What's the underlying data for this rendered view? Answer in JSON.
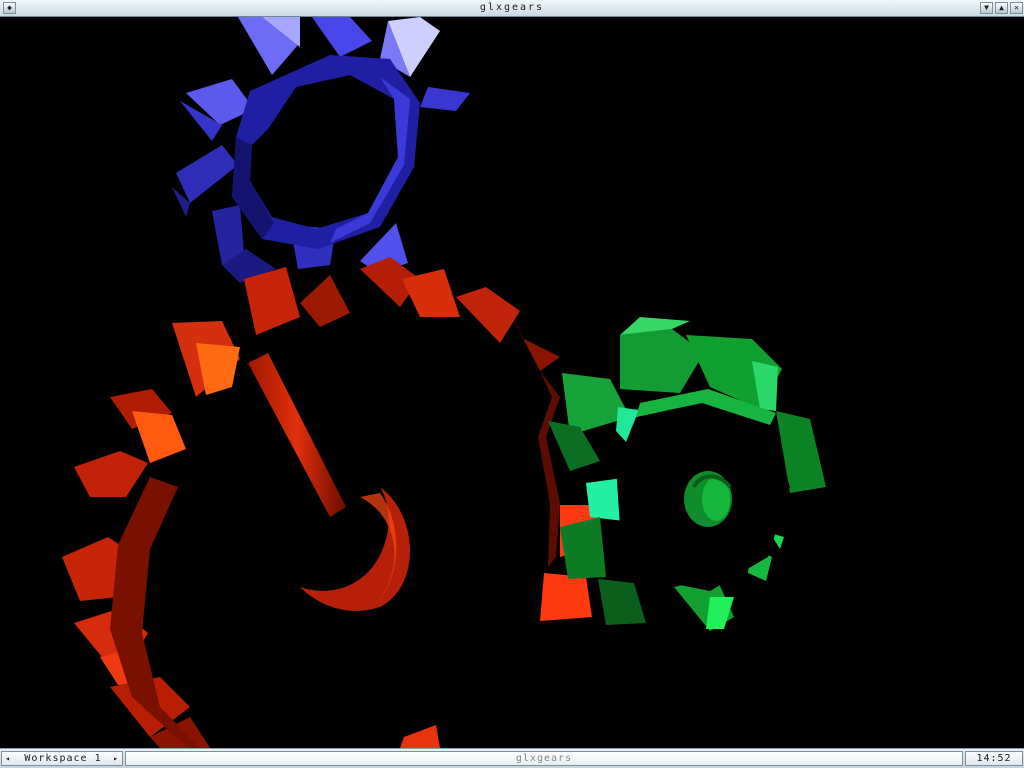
{
  "window": {
    "title": "glxgears",
    "buttons": {
      "menu_icon": "diamond-menu-icon",
      "minimize_icon": "chevron-down-icon",
      "maximize_icon": "chevron-up-icon",
      "close_icon": "close-icon"
    }
  },
  "scene": {
    "gears": [
      {
        "name": "red-gear",
        "color": "#d42a0a"
      },
      {
        "name": "green-gear",
        "color": "#0f9a2a"
      },
      {
        "name": "blue-gear",
        "color": "#2a2ad0"
      }
    ],
    "background": "#000000"
  },
  "toolbar": {
    "workspace_label": "Workspace 1",
    "workspace_prev": "◂",
    "workspace_next": "▸",
    "task_label": "glxgears",
    "clock": "14:52"
  },
  "theme": {
    "titlebar_bg": "#dde8ee",
    "toolbar_bg": "#d5e2e9"
  }
}
